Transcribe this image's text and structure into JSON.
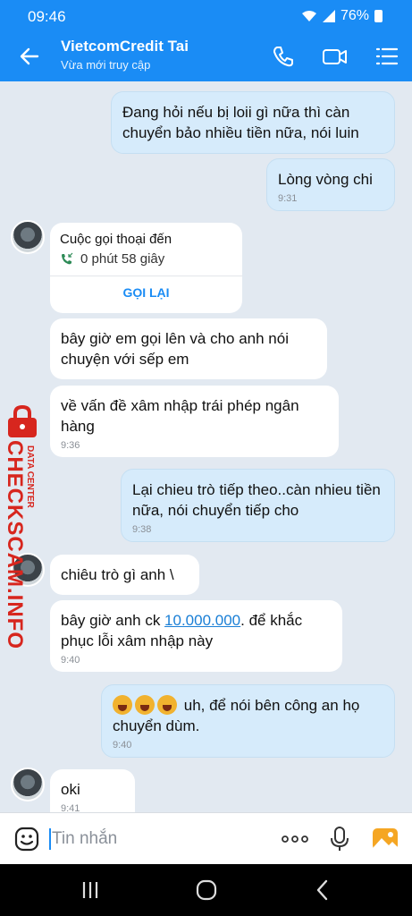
{
  "status": {
    "time": "09:46",
    "battery": "76%"
  },
  "header": {
    "title": "VietcomCredit Tai",
    "subtitle": "Vừa mới truy cập"
  },
  "messages": {
    "m1": {
      "text": "Đang hỏi nếu bị loii gì nữa thì càn chuyển bảo nhiều tiền nữa, nói luin"
    },
    "m2": {
      "text": "Lòng vòng chi",
      "time": "9:31"
    },
    "call": {
      "title": "Cuộc gọi thoại đến",
      "duration": "0 phút 58 giây",
      "button": "GỌI LẠI"
    },
    "m3": {
      "text": "bây giờ em gọi lên và cho anh nói chuyện với sếp em"
    },
    "m4": {
      "text": "về vấn đề xâm nhập trái phép ngân hàng",
      "time": "9:36"
    },
    "m5": {
      "text": "Lại chieu trò tiếp theo..càn nhieu tiền nữa,  nói chuyển tiếp cho",
      "time": "9:38"
    },
    "m6": {
      "text": "chiêu trò gì anh \\"
    },
    "m7": {
      "pre": "bây giờ anh ck ",
      "link": "10.000.000",
      "post": ". để khắc phục lỗi xâm nhập này",
      "time": "9:40"
    },
    "m8": {
      "text": "uh, để nói bên công an họ chuyển dùm.",
      "time": "9:40"
    },
    "m9": {
      "text": "oki",
      "time": "9:41"
    }
  },
  "watermark": {
    "brand": "CHECKSCAM.INFO",
    "tag": "DATA CENTER"
  },
  "input": {
    "placeholder": "Tin nhắn"
  },
  "icons": {
    "back": "arrow-left-icon",
    "call": "phone-icon",
    "video": "video-camera-icon",
    "menu": "list-menu-icon",
    "sticker": "sticker-smile-icon",
    "more": "more-dots-icon",
    "mic": "microphone-icon",
    "gallery": "image-gallery-icon"
  },
  "colors": {
    "accent": "#1a8cf5",
    "outgoing": "#d6ebfb",
    "incoming": "#ffffff",
    "watermark": "#d7261e"
  }
}
